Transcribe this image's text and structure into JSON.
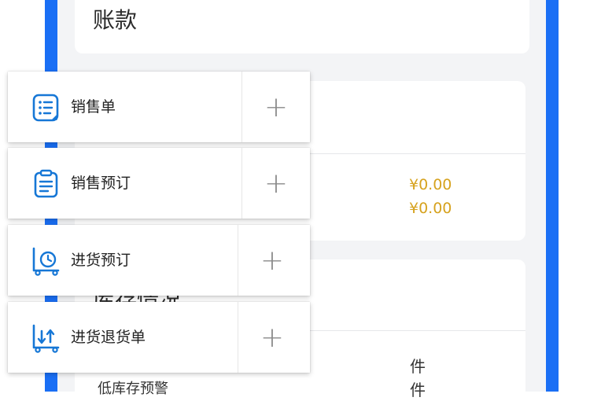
{
  "background": {
    "top_title": "账款",
    "amounts": [
      "¥0.00",
      "¥0.00"
    ],
    "stock_heading": "库存情况",
    "low_stock_label": "低库存预警",
    "units": [
      "件",
      "件"
    ],
    "accent_color": "#1a6ff5",
    "amount_color": "#d6a21e"
  },
  "menu": {
    "items": [
      {
        "label": "销售单",
        "icon": "list-document-icon",
        "add": "+"
      },
      {
        "label": "销售预订",
        "icon": "clipboard-icon",
        "add": "+"
      },
      {
        "label": "进货预订",
        "icon": "cart-clock-icon",
        "add": "+"
      },
      {
        "label": "进货退货单",
        "icon": "return-arrows-icon",
        "add": "+"
      }
    ],
    "icon_color": "#1677d6"
  }
}
